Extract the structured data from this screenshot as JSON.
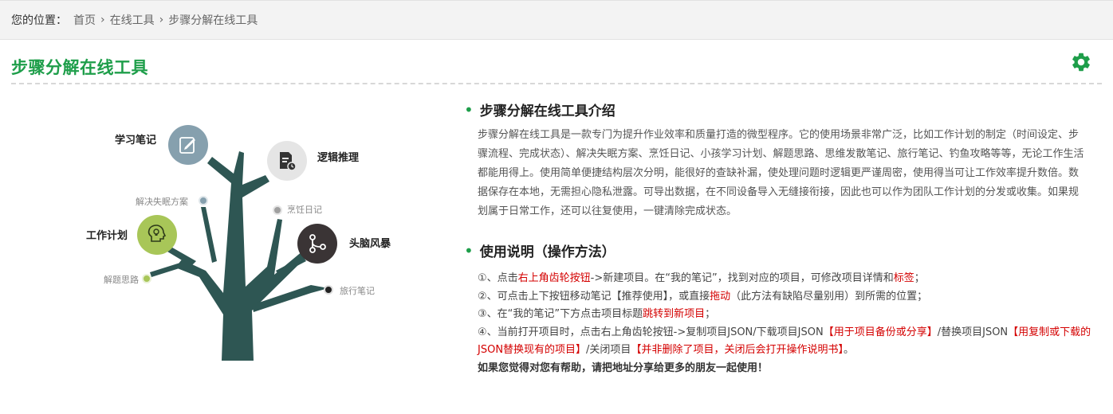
{
  "breadcrumb": {
    "prefix": "您的位置：",
    "items": [
      "首页",
      "在线工具",
      "步骤分解在线工具"
    ],
    "separator": "›"
  },
  "page": {
    "title": "步骤分解在线工具",
    "accent_color": "#1e9e4a",
    "settings_icon": "gear-icon"
  },
  "illustration": {
    "branches": [
      "学习笔记",
      "逻辑推理",
      "工作计划",
      "头脑风暴"
    ],
    "small_labels": [
      "解决失眠方案",
      "烹饪日记",
      "解题思路",
      "旅行笔记"
    ],
    "icons": [
      "edit-icon",
      "document-clock-icon",
      "head-bulb-icon",
      "share-nodes-icon"
    ]
  },
  "intro": {
    "title": "步骤分解在线工具介绍",
    "text": "步骤分解在线工具是一款专门为提升作业效率和质量打造的微型程序。它的使用场景非常广泛，比如工作计划的制定（时间设定、步骤流程、完成状态）、解决失眠方案、烹饪日记、小孩学习计划、解题思路、思维发散笔记、旅行笔记、钓鱼攻略等等，无论工作生活都能用得上。使用简单便捷结构层次分明，能很好的查缺补漏，使处理问题时逻辑更严谨周密，使用得当可让工作效率提升数倍。数据保存在本地，无需担心隐私泄露。可导出数据，在不同设备导入无缝接衔接，因此也可以作为团队工作计划的分发或收集。如果规划属于日常工作，还可以往复使用，一键清除完成状态。"
  },
  "usage": {
    "title": "使用说明（操作方法）",
    "item1": {
      "p1": "①、点击",
      "r1": "右上角齿轮按钮",
      "p2": "->新建项目。在“我的笔记”，找到对应的项目，可修改项目详情和",
      "r2": "标签",
      "p3": "；"
    },
    "item2": {
      "p1": "②、可点击上下按钮移动笔记【推荐使用】，或直接",
      "r1": "拖动",
      "p2": "（此方法有缺陷尽量别用）到所需的位置；"
    },
    "item3": {
      "p1": "③、在“我的笔记”下方点击项目标题",
      "r1": "跳转到新项目",
      "p2": "；"
    },
    "item4": {
      "p1": "④、当前打开项目时，点击右上角齿轮按钮->复制项目JSON/下载项目JSON",
      "r1": "【用于项目备份或分享】",
      "p2": "/替换项目JSON",
      "r2": "【用复制或下载的JSON替换现有的项目】",
      "p3": "/关闭项目",
      "r3": "【并非删除了项目，关闭后会打开操作说明书】",
      "p4": "。"
    },
    "share_note": "如果您觉得对您有帮助，请把地址分享给更多的朋友一起使用！"
  }
}
